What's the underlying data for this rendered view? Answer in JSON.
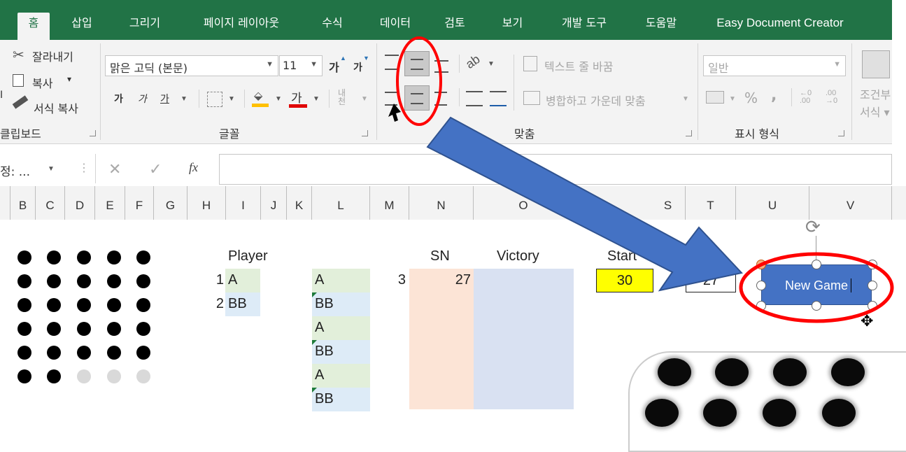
{
  "tabs": [
    "홈",
    "삽입",
    "그리기",
    "페이지 레이아웃",
    "수식",
    "데이터",
    "검토",
    "보기",
    "개발 도구",
    "도움말",
    "Easy Document Creator"
  ],
  "clipboard": {
    "cut": "잘라내기",
    "copy": "복사",
    "copy_arrow": "▾",
    "format_painter": "서식 복사",
    "group": "클립보드",
    "left_stub": "I"
  },
  "font": {
    "name": "맑은 고딕 (본문)",
    "size": "11",
    "bold": "가",
    "italic": "가",
    "underline": "가",
    "grow": "가",
    "shrink": "가",
    "color_letter": "가",
    "phonetic": "내천",
    "group": "글꼴"
  },
  "alignment": {
    "wrap": "텍스트 줄 바꿈",
    "merge": "병합하고 가운데 맞춤",
    "group": "맞춤"
  },
  "number": {
    "format": "일반",
    "percent": "%",
    "comma": ",",
    "group": "표시 형식"
  },
  "styles": {
    "conditional": "조건부",
    "table": "서식 ▾"
  },
  "formula_bar": {
    "name_box": "정: ...",
    "fx": "fx",
    "cancel": "✕",
    "enter": "✓"
  },
  "columns": [
    "B",
    "C",
    "D",
    "E",
    "F",
    "G",
    "H",
    "I",
    "J",
    "K",
    "L",
    "M",
    "N",
    "O",
    "S",
    "T",
    "U",
    "V"
  ],
  "sheet": {
    "player_header": "Player",
    "players": [
      {
        "num": "1",
        "name": "A"
      },
      {
        "num": "2",
        "name": "BB"
      }
    ],
    "l_column": [
      "A",
      "BB",
      "A",
      "BB",
      "A",
      "BB"
    ],
    "m_value": "3",
    "sn_header": "SN",
    "sn_value": "27",
    "victory_header": "Victory",
    "start_header": "Start",
    "start_value": "30",
    "t_value": "27",
    "dot_grid": [
      [
        "black",
        "black",
        "black",
        "black",
        "black"
      ],
      [
        "black",
        "black",
        "black",
        "black",
        "black"
      ],
      [
        "black",
        "black",
        "black",
        "black",
        "black"
      ],
      [
        "black",
        "black",
        "black",
        "black",
        "black"
      ],
      [
        "black",
        "black",
        "black",
        "black",
        "black"
      ],
      [
        "black",
        "black",
        "gray",
        "gray",
        "gray"
      ]
    ]
  },
  "new_game_button": {
    "label": "New Game"
  },
  "colors": {
    "excel_green": "#217346",
    "annotation_red": "#ff0000",
    "arrow_blue": "#4472c4",
    "start_yellow": "#ffff00"
  }
}
